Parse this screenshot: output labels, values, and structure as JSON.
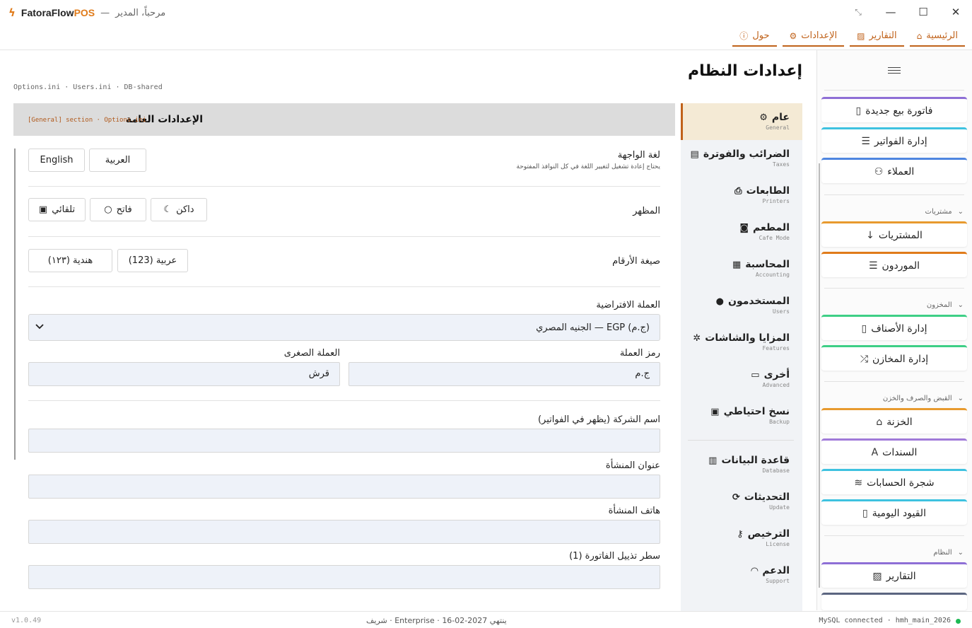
{
  "titlebar": {
    "app_name_main": "FatoraFlow",
    "app_name_accent": "POS",
    "separator": "—",
    "greeting": "مرحباً، المدير",
    "pin_icon": "pin-icon",
    "minimize": "—",
    "maximize": "☐",
    "close": "✕"
  },
  "top_tabs": [
    {
      "label": "الرئيسية",
      "icon": "home-icon",
      "glyph": "⌂"
    },
    {
      "label": "التقارير",
      "icon": "chart-icon",
      "glyph": "▨"
    },
    {
      "label": "الإعدادات",
      "icon": "gear-icon",
      "glyph": "⚙"
    },
    {
      "label": "حول",
      "icon": "info-icon",
      "glyph": "ⓘ"
    }
  ],
  "sidebar": {
    "items": [
      {
        "label": "فاتورة بيع جديدة",
        "glyph": "▯",
        "color": "#8e6fd6"
      },
      {
        "label": "إدارة الفواتير",
        "glyph": "☰",
        "color": "#3ec2e0"
      },
      {
        "label": "العملاء",
        "glyph": "⚇",
        "color": "#4f86e0"
      },
      {
        "label": "المشتريات",
        "glyph": "↓",
        "color": "#e89a2e"
      },
      {
        "label": "الموردون",
        "glyph": "☰",
        "color": "#e07b1a"
      },
      {
        "label": "إدارة الأصناف",
        "glyph": "▯",
        "color": "#3ecf86"
      },
      {
        "label": "إدارة المخازن",
        "glyph": "⤮",
        "color": "#3ecf86"
      },
      {
        "label": "الخزنة",
        "glyph": "🔒",
        "color": "#e89a2e"
      },
      {
        "label": "السندات",
        "glyph": "A",
        "color": "#a07ad9"
      },
      {
        "label": "شجرة الحسابات",
        "glyph": "≋",
        "color": "#3ec2e0"
      },
      {
        "label": "القيود اليومية",
        "glyph": "▯",
        "color": "#3ec2e0"
      },
      {
        "label": "التقارير",
        "glyph": "▨",
        "color": "#8e6fd6"
      }
    ],
    "sections": {
      "purchases": "مشتريات",
      "inventory": "المخزون",
      "cash": "القبض والصرف والخزن",
      "system": "النظام"
    }
  },
  "page": {
    "title": "إعدادات النظام",
    "breadcrumb": "Options.ini · Users.ini · DB-shared"
  },
  "settings_nav": [
    {
      "label": "عام",
      "sub": "General",
      "glyph": "⚙"
    },
    {
      "label": "الضرائب والفوترة",
      "sub": "Taxes",
      "glyph": "▤"
    },
    {
      "label": "الطابعات",
      "sub": "Printers",
      "glyph": "⎙"
    },
    {
      "label": "المطعم",
      "sub": "Cafe Mode",
      "glyph": "◙"
    },
    {
      "label": "المحاسبة",
      "sub": "Accounting",
      "glyph": "▦"
    },
    {
      "label": "المستخدمون",
      "sub": "Users",
      "glyph": "●"
    },
    {
      "label": "المزايا والشاشات",
      "sub": "Features",
      "glyph": "✲"
    },
    {
      "label": "أخرى",
      "sub": "Advanced",
      "glyph": "▭"
    },
    {
      "label": "نسخ احتياطي",
      "sub": "Backup",
      "glyph": "▣"
    },
    {
      "label": "قاعدة البيانات",
      "sub": "Database",
      "glyph": "▥"
    },
    {
      "label": "التحديثات",
      "sub": "Update",
      "glyph": "⟳"
    },
    {
      "label": "الترخيص",
      "sub": "License",
      "glyph": "⚷"
    },
    {
      "label": "الدعم",
      "sub": "Support",
      "glyph": "◠"
    }
  ],
  "general": {
    "title": "الإعدادات العامة",
    "note": "[General] section · Options.ini",
    "language_label": "لغة الواجهة",
    "language_hint": "يحتاج إعادة تشغيل لتغيير اللغة في كل النوافذ المفتوحة",
    "lang_arabic": "العربية",
    "lang_english": "English",
    "theme_label": "المظهر",
    "theme_dark": "داكن",
    "theme_light": "فاتح",
    "theme_auto": "تلقائي",
    "digits_label": "صيغة الأرقام",
    "digits_arabic": "عربية (123)",
    "digits_hindi": "هندية (١٢٣)",
    "currency_label": "العملة الافتراضية",
    "currency_value": "الجنيه المصري — EGP (ج.م)",
    "symbol_label": "رمز العملة",
    "symbol_value": "ج.م",
    "minor_label": "العملة الصغرى",
    "minor_value": "قرش",
    "company_label": "اسم الشركة (يظهر في الفواتير)",
    "company_value": "",
    "address_label": "عنوان المنشأة",
    "address_value": "",
    "phone_label": "هاتف المنشأة",
    "phone_value": "",
    "footer1_label": "سطر تذييل الفاتورة (1)",
    "footer1_value": ""
  },
  "statusbar": {
    "version": "v1.0.49",
    "license": "شريف · Enterprise · ينتهي 2027-02-16",
    "db": "MySQL connected · hmh_main_2026",
    "status_color": "#1db954"
  },
  "colors": {
    "accent": "#c0621a",
    "active_nav_bg": "#f4ead5"
  }
}
